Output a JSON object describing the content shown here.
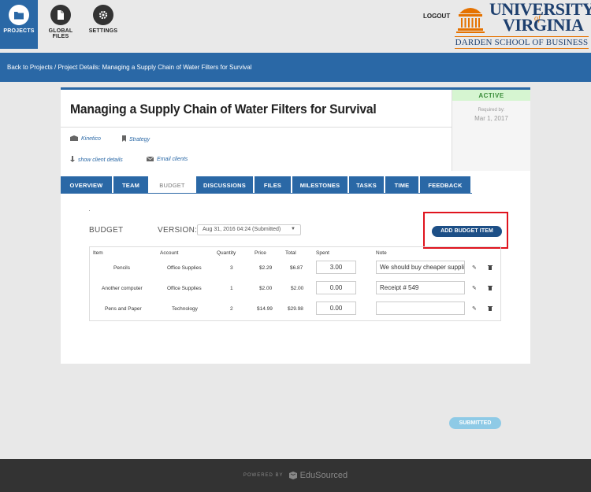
{
  "nav": {
    "projects_label": "PROJECTS",
    "global_files_label": "GLOBAL FILES",
    "settings_label": "SETTINGS",
    "logout_label": "LOGOUT"
  },
  "logo": {
    "university": "UNIVERSITY",
    "of": "of",
    "virginia": "VIRGINIA",
    "school": "DARDEN SCHOOL OF BUSINESS",
    "colors": {
      "navy": "#1d3f6e",
      "orange": "#e57200"
    }
  },
  "breadcrumb": "Back to Projects / Project Details: Managing a Supply Chain of Water Filters for Survival",
  "project": {
    "title": "Managing a Supply Chain of Water Filters for Survival",
    "company": "Kinetico",
    "category": "Strategy",
    "show_client_details": "show client details",
    "email_clients": "Email clients",
    "status": "ACTIVE",
    "required_by_label": "Required by:",
    "required_by_date": "Mar 1, 2017"
  },
  "tabs": [
    {
      "label": "OVERVIEW"
    },
    {
      "label": "TEAM"
    },
    {
      "label": "BUDGET",
      "active": true
    },
    {
      "label": "DISCUSSIONS"
    },
    {
      "label": "FILES"
    },
    {
      "label": "MILESTONES"
    },
    {
      "label": "TASKS"
    },
    {
      "label": "TIME"
    },
    {
      "label": "FEEDBACK"
    }
  ],
  "budget": {
    "heading": "BUDGET",
    "version_label": "VERSION:",
    "version_value": "Aug 31, 2016 04:24 (Submitted)",
    "add_button": "ADD BUDGET ITEM",
    "submitted_button": "SUBMITTED",
    "columns": [
      "Item",
      "Account",
      "Quantity",
      "Price",
      "Total",
      "Spent",
      "Note"
    ],
    "rows": [
      {
        "item": "Pencils",
        "account": "Office Supplies",
        "quantity": "3",
        "price": "$2.29",
        "total": "$6.87",
        "spent": "3.00",
        "note": "We should buy cheaper suppli"
      },
      {
        "item": "Another computer",
        "account": "Office Supplies",
        "quantity": "1",
        "price": "$2.00",
        "total": "$2.00",
        "spent": "0.00",
        "note": "Receipt # 549"
      },
      {
        "item": "Pens and Paper",
        "account": "Technology",
        "quantity": "2",
        "price": "$14.99",
        "total": "$29.98",
        "spent": "0.00",
        "note": ""
      }
    ]
  },
  "footer": {
    "powered_by": "POWERED BY",
    "brand": "EduSourced"
  },
  "colors": {
    "primary": "#2a68a6",
    "active_status_bg": "#d6f5d1",
    "highlight": "#e0141e"
  }
}
